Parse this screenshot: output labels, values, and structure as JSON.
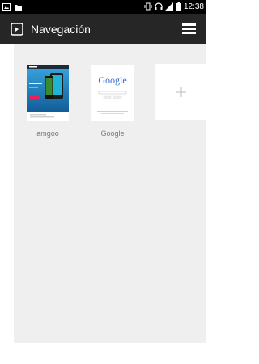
{
  "status_bar": {
    "time": "12:38",
    "icons": [
      "image-icon",
      "folder-icon",
      "vibrate-icon",
      "headset-icon",
      "signal-icon",
      "battery-icon"
    ]
  },
  "app_bar": {
    "title": "Navegación",
    "nav_icon": "navigation-icon",
    "menu_icon": "menu-icon"
  },
  "speed_dial": {
    "tiles": [
      {
        "label": "amgoo",
        "thumbnail": "amgoo-site-thumbnail"
      },
      {
        "label": "Google",
        "thumbnail": "google-site-thumbnail",
        "logo_text": "Google"
      }
    ],
    "add_icon": "plus-icon"
  },
  "colors": {
    "status_bar": "#000000",
    "app_bar": "#262626",
    "content_bg": "#efefef",
    "tile_label": "#7a7a7a"
  }
}
